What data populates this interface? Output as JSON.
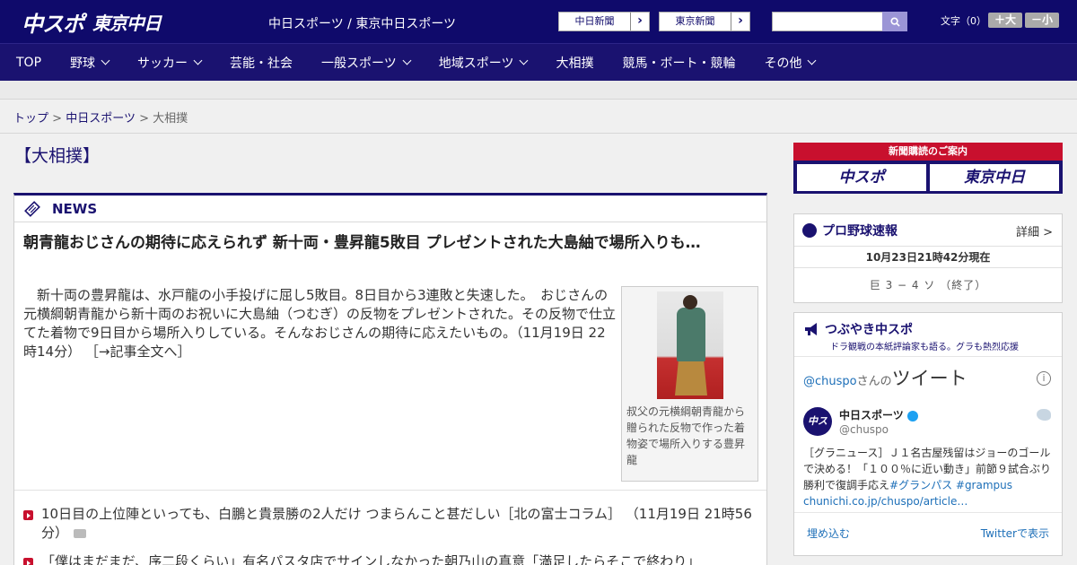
{
  "header": {
    "logo_1": "中スポ",
    "logo_2": "東京中日",
    "site_title": "中日スポーツ / 東京中日スポーツ",
    "paper_links": [
      "中日新聞",
      "東京新聞"
    ],
    "font_label": "文字（0）",
    "size_up": "＋大",
    "size_down": "－小"
  },
  "nav": {
    "items": [
      {
        "label": "TOP",
        "dropdown": false
      },
      {
        "label": "野球",
        "dropdown": true
      },
      {
        "label": "サッカー",
        "dropdown": true
      },
      {
        "label": "芸能・社会",
        "dropdown": false
      },
      {
        "label": "一般スポーツ",
        "dropdown": true
      },
      {
        "label": "地域スポーツ",
        "dropdown": true
      },
      {
        "label": "大相撲",
        "dropdown": false
      },
      {
        "label": "競馬・ボート・競輪",
        "dropdown": false
      },
      {
        "label": "その他",
        "dropdown": true
      }
    ]
  },
  "breadcrumb": {
    "home": "トップ",
    "sep": ">",
    "section": "中日スポーツ",
    "current": "大相撲"
  },
  "page": {
    "title": "【大相撲】"
  },
  "news": {
    "label": "NEWS",
    "lead_title": "朝青龍おじさんの期待に応えられず 新十両・豊昇龍5敗目 プレゼントされた大島紬で場所入りも…",
    "lead_body": "　新十両の豊昇龍は、水戸龍の小手投げに屈し5敗目。8日目から3連敗と失速した。　おじさんの元横綱朝青龍から新十両のお祝いに大島紬（つむぎ）の反物をプレゼントされた。その反物で仕立てた着物で9日目から場所入りしている。そんなおじさんの期待に応えたいもの。（11月19日 22時14分）",
    "lead_more": "［→記事全文へ］",
    "photo_caption": "叔父の元横綱朝青龍から贈られた反物で作った着物姿で場所入りする豊昇龍",
    "items": [
      {
        "text": "10日目の上位陣といっても、白鵬と貴景勝の2人だけ つまらんこと甚だしい［北の富士コラム］ （11月19日 21時56分）",
        "photo": true
      },
      {
        "text": "「僕はまだまだ、序二段くらい」有名パスタ店でサインしなかった朝乃山の真意「満足したらそこで終わり」",
        "photo": false
      }
    ]
  },
  "sidebar": {
    "promo_header": "新聞購読のご案内",
    "promo_1": "中スポ",
    "promo_2": "東京中日",
    "pro": {
      "title": "プロ野球速報",
      "detail": "詳細 >",
      "time": "10月23日21時42分現在",
      "score": "巨 3 − 4 ソ （終了）"
    },
    "twitter": {
      "title": "つぶやき中スポ",
      "subtitle": "ドラ観戦の本紙評論家も語る。グラも熱烈応援",
      "widget_handle_link": "@chuspo",
      "widget_san": "さんの",
      "widget_title": "ツイート",
      "info": "i",
      "avatar_text": "中スポ",
      "name": "中日スポーツ",
      "handle": "@chuspo",
      "tweet_text": "［グラニュース］Ｊ１名古屋残留はジョーのゴールで決める！「１００％に近い動き」前節９試合ぶり勝利で復調手応え",
      "tweet_tags": "#グランパス #grampus",
      "tweet_link": "chunichi.co.jp/chuspo/article…",
      "embed": "埋め込む",
      "view": "Twitterで表示"
    }
  },
  "colors": {
    "brand_navy": "#1a1270",
    "header_navy": "#0f0a6b",
    "accent_red": "#c8102e",
    "link_blue": "#1d6fb8"
  }
}
